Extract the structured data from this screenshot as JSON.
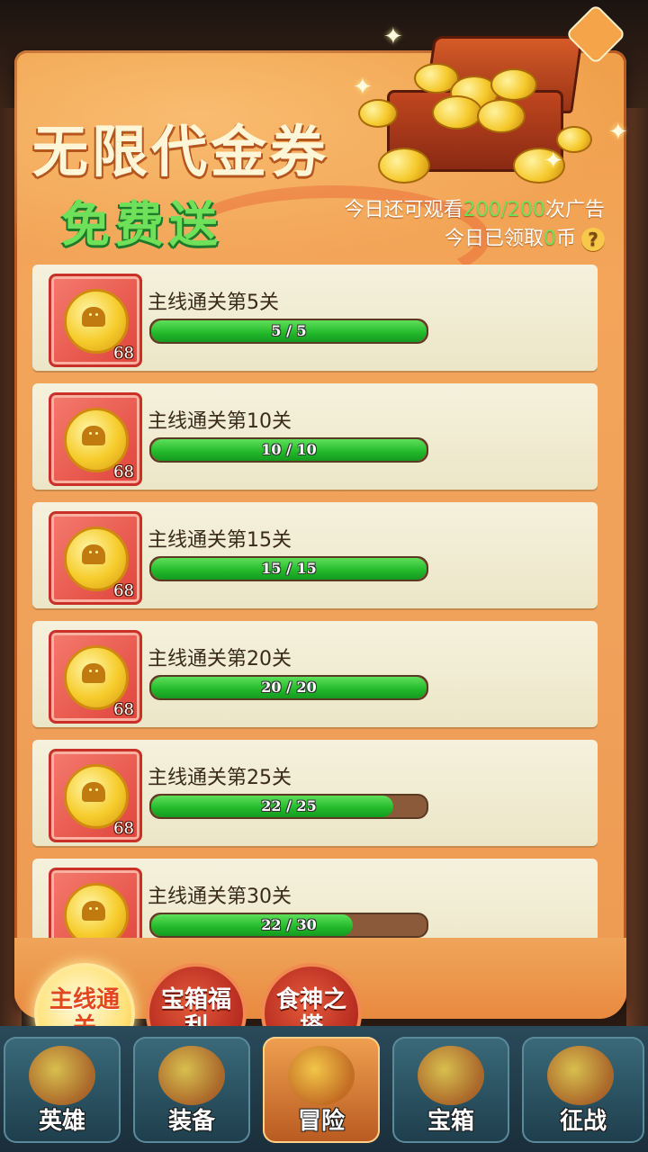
{
  "header": {
    "title": "无限代金券",
    "subtitle": "免费送",
    "ad_prefix": "今日还可观看",
    "ad_count": "200/200",
    "ad_suffix": "次广告",
    "claim_prefix": "今日已领取",
    "claim_count": "0",
    "claim_suffix": "币",
    "help_icon": "?"
  },
  "quests": [
    {
      "label": "主线通关第5关",
      "reward": "68",
      "progress_text": "5 / 5",
      "progress": 1.0
    },
    {
      "label": "主线通关第10关",
      "reward": "68",
      "progress_text": "10 / 10",
      "progress": 1.0
    },
    {
      "label": "主线通关第15关",
      "reward": "68",
      "progress_text": "15 / 15",
      "progress": 1.0
    },
    {
      "label": "主线通关第20关",
      "reward": "68",
      "progress_text": "20 / 20",
      "progress": 1.0
    },
    {
      "label": "主线通关第25关",
      "reward": "68",
      "progress_text": "22 / 25",
      "progress": 0.88
    },
    {
      "label": "主线通关第30关",
      "reward": "68",
      "progress_text": "22 / 30",
      "progress": 0.733
    }
  ],
  "tabs": [
    {
      "label": "主线通关",
      "active": true
    },
    {
      "label": "宝箱福利",
      "active": false
    },
    {
      "label": "食神之塔",
      "active": false
    }
  ],
  "nav": [
    {
      "label": "英雄",
      "active": false
    },
    {
      "label": "装备",
      "active": false
    },
    {
      "label": "冒险",
      "active": true
    },
    {
      "label": "宝箱",
      "active": false
    },
    {
      "label": "征战",
      "active": false
    }
  ],
  "colors": {
    "accent_green": "#6ee05a",
    "panel_orange": "#f0a04a",
    "bar_green": "#22b82a",
    "bar_empty": "#8a5a3a"
  }
}
